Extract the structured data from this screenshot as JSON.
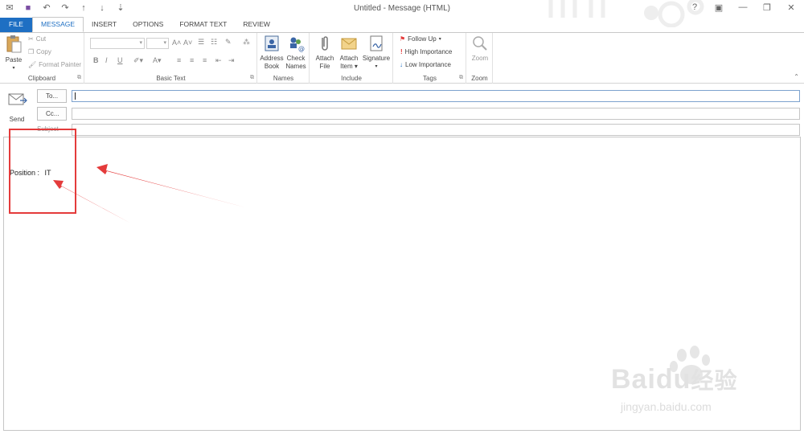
{
  "window": {
    "title": "Untitled - Message (HTML)",
    "controls": [
      "?",
      "▣",
      "—",
      "❐",
      "✕"
    ]
  },
  "qat": [
    "save-icon",
    "undo-icon",
    "redo-icon",
    "up-icon",
    "down-icon",
    "customize-icon"
  ],
  "tabs": [
    {
      "label": "FILE"
    },
    {
      "label": "MESSAGE"
    },
    {
      "label": "INSERT"
    },
    {
      "label": "OPTIONS"
    },
    {
      "label": "FORMAT TEXT"
    },
    {
      "label": "REVIEW"
    }
  ],
  "ribbon": {
    "clipboard": {
      "label": "Clipboard",
      "paste": "Paste",
      "cut": "Cut",
      "copy": "Copy",
      "format_painter": "Format Painter"
    },
    "basic_text": {
      "label": "Basic Text"
    },
    "names": {
      "label": "Names",
      "address_book": [
        "Address",
        "Book"
      ],
      "check_names": [
        "Check",
        "Names"
      ]
    },
    "include": {
      "label": "Include",
      "attach_file": [
        "Attach",
        "File"
      ],
      "attach_item": [
        "Attach",
        "Item"
      ],
      "signature": "Signature"
    },
    "tags": {
      "label": "Tags",
      "follow_up": "Follow Up",
      "high_importance": "High Importance",
      "low_importance": "Low Importance"
    },
    "zoom": {
      "label": "Zoom",
      "zoom": "Zoom"
    }
  },
  "header": {
    "send": "Send",
    "to": "To...",
    "cc": "Cc...",
    "subject": "Subject"
  },
  "body": {
    "position_label": "Position :",
    "position_value": "IT"
  },
  "annotation": {
    "color": "#e43b3b"
  },
  "watermark": {
    "brand": "Baidu",
    "cn": "经验",
    "url": "jingyan.baidu.com"
  },
  "colors": {
    "accent": "#1e6fc3",
    "file_tab": "#1e6fc3"
  }
}
